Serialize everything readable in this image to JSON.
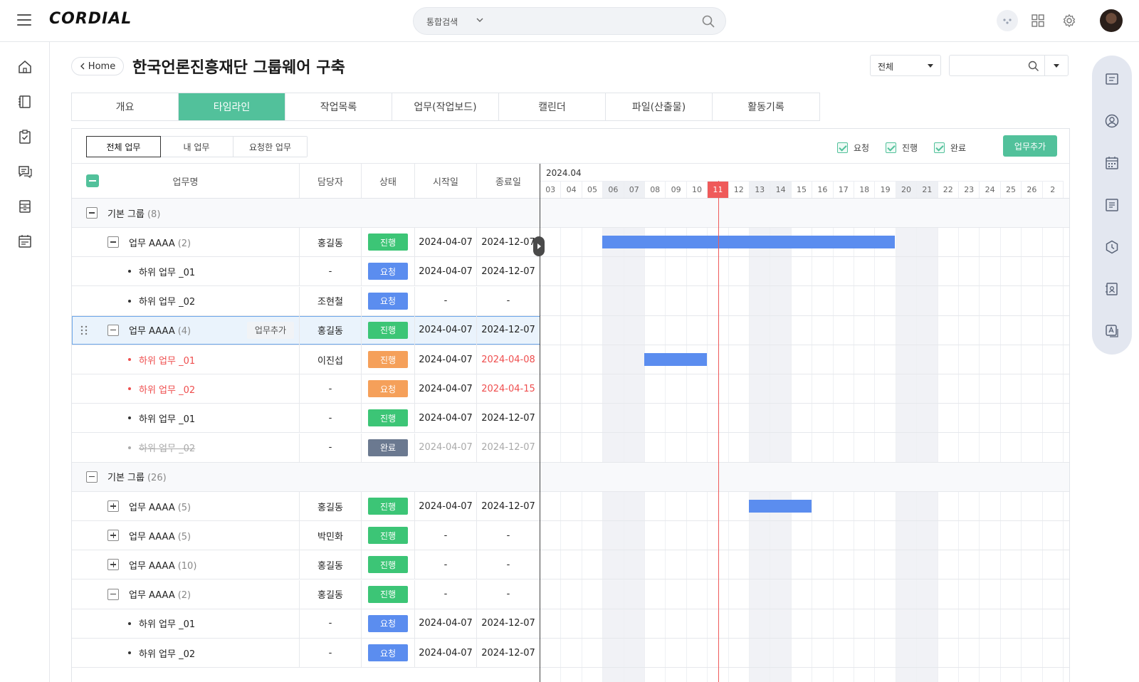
{
  "topbar": {
    "logo": "CORDIAL",
    "search_scope": "통합검색",
    "search_placeholder": ""
  },
  "header": {
    "back_label": "Home",
    "title": "한국언론진흥재단 그룹웨어 구축",
    "filter_select_value": "전체",
    "filter_input_placeholder": ""
  },
  "tabs": [
    {
      "label": "개요",
      "active": false
    },
    {
      "label": "타임라인",
      "active": true
    },
    {
      "label": "작업목록",
      "active": false
    },
    {
      "label": "업무(작업보드)",
      "active": false
    },
    {
      "label": "캘린더",
      "active": false
    },
    {
      "label": "파일(산출물)",
      "active": false
    },
    {
      "label": "활동기록",
      "active": false
    }
  ],
  "filter_tabs": [
    {
      "label": "전체 업무",
      "active": true
    },
    {
      "label": "내 업무",
      "active": false
    },
    {
      "label": "요청한 업무",
      "active": false
    }
  ],
  "status_filters": [
    {
      "label": "요청",
      "checked": true
    },
    {
      "label": "진행",
      "checked": true
    },
    {
      "label": "완료",
      "checked": true
    }
  ],
  "add_task_label": "업무추가",
  "columns": {
    "name": "업무명",
    "assignee": "담당자",
    "status": "상태",
    "start": "시작일",
    "end": "종료일"
  },
  "timeline": {
    "month": "2024.04",
    "days": [
      "03",
      "04",
      "05",
      "06",
      "07",
      "08",
      "09",
      "10",
      "11",
      "12",
      "13",
      "14",
      "15",
      "16",
      "17",
      "18",
      "19",
      "20",
      "21",
      "22",
      "23",
      "24",
      "25",
      "26",
      "2"
    ],
    "weekend_days": [
      "06",
      "07",
      "13",
      "14",
      "20",
      "21"
    ],
    "today": "11"
  },
  "rows": [
    {
      "type": "group",
      "label": "기본 그룹",
      "count": "(8)"
    },
    {
      "type": "task",
      "toggle": "minus",
      "label": "업무 AAAA",
      "count": "(2)",
      "assignee": "홍길동",
      "status": "진행",
      "status_color": "prog",
      "start": "2024-04-07",
      "end": "2024-12-07",
      "bar": {
        "from_day": 5,
        "to_day": 19
      }
    },
    {
      "type": "sub",
      "label": "하위 업무 _01",
      "assignee": "-",
      "status": "요청",
      "status_color": "req",
      "start": "2024-04-07",
      "end": "2024-12-07"
    },
    {
      "type": "sub",
      "label": "하위 업무 _02",
      "assignee": "조현철",
      "status": "요청",
      "status_color": "req",
      "start": "-",
      "end": "-"
    },
    {
      "type": "task",
      "toggle": "minus",
      "label": "업무 AAAA",
      "count": "(4)",
      "assignee": "홍길동",
      "status": "진행",
      "status_color": "prog",
      "start": "2024-04-07",
      "end": "2024-12-07",
      "selected": true,
      "inline_add": "업무추가"
    },
    {
      "type": "sub",
      "label": "하위 업무 _01",
      "assignee": "이진섭",
      "status": "진행",
      "status_color": "orange",
      "start": "2024-04-07",
      "end": "2024-04-08",
      "overdue": true,
      "bar": {
        "from_day": 7,
        "to_day": 10
      }
    },
    {
      "type": "sub",
      "label": "하위 업무 _02",
      "assignee": "-",
      "status": "요청",
      "status_color": "orange",
      "start": "2024-04-07",
      "end": "2024-04-15",
      "overdue": true
    },
    {
      "type": "sub",
      "label": "하위 업무 _01",
      "assignee": "-",
      "status": "진행",
      "status_color": "prog",
      "start": "2024-04-07",
      "end": "2024-12-07"
    },
    {
      "type": "sub",
      "label": "하위 업무 _02",
      "assignee": "-",
      "status": "완료",
      "status_color": "done",
      "start": "2024-04-07",
      "end": "2024-12-07",
      "done": true
    },
    {
      "type": "group",
      "label": "기본 그룹",
      "count": "(26)"
    },
    {
      "type": "task",
      "toggle": "plus",
      "label": "업무 AAAA",
      "count": "(5)",
      "assignee": "홍길동",
      "status": "진행",
      "status_color": "prog",
      "start": "2024-04-07",
      "end": "2024-12-07",
      "bar": {
        "from_day": 12,
        "to_day": 15
      }
    },
    {
      "type": "task",
      "toggle": "plus",
      "label": "업무 AAAA",
      "count": "(5)",
      "assignee": "박민화",
      "status": "진행",
      "status_color": "prog",
      "start": "-",
      "end": "-"
    },
    {
      "type": "task",
      "toggle": "plus",
      "label": "업무 AAAA",
      "count": "(10)",
      "assignee": "홍길동",
      "status": "진행",
      "status_color": "prog",
      "start": "-",
      "end": "-"
    },
    {
      "type": "task",
      "toggle": "minus",
      "label": "업무 AAAA",
      "count": "(2)",
      "assignee": "홍길동",
      "status": "진행",
      "status_color": "prog",
      "start": "-",
      "end": "-"
    },
    {
      "type": "sub",
      "label": "하위 업무 _01",
      "assignee": "-",
      "status": "요청",
      "status_color": "req",
      "start": "2024-04-07",
      "end": "2024-12-07"
    },
    {
      "type": "sub",
      "label": "하위 업무 _02",
      "assignee": "-",
      "status": "요청",
      "status_color": "req",
      "start": "2024-04-07",
      "end": "2024-12-07"
    }
  ],
  "icons": {
    "left_nav": [
      "home-icon",
      "notebook-icon",
      "clipboard-check-icon",
      "chat-icon",
      "archive-icon",
      "calendar-list-icon"
    ],
    "right_rail": [
      "inbox-icon",
      "user-circle-icon",
      "calendar-icon",
      "document-icon",
      "clock-icon",
      "contact-book-icon",
      "translate-icon"
    ]
  }
}
